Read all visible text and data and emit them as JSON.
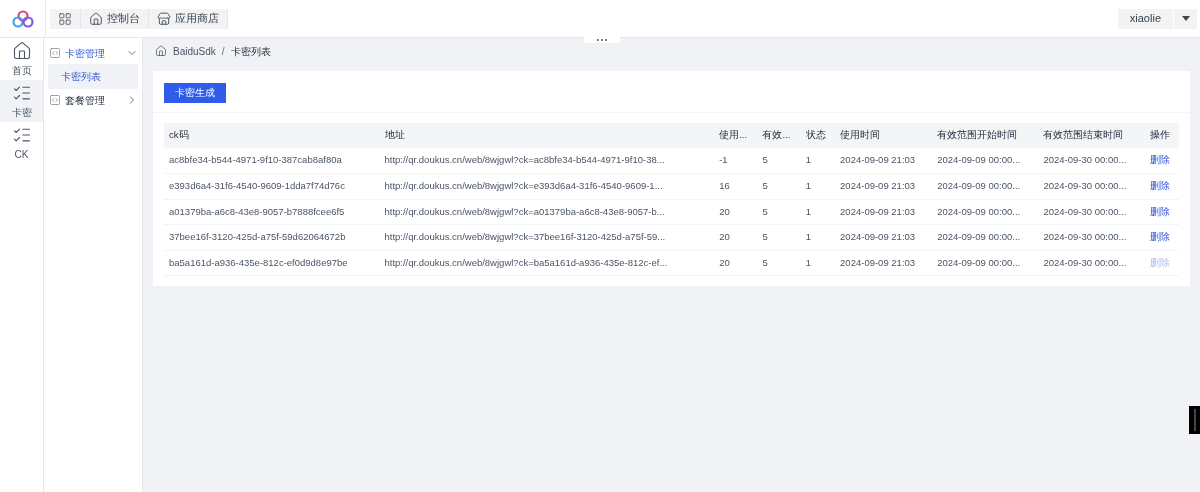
{
  "top_tabs": [
    {
      "label": "控制台",
      "kind": "home"
    },
    {
      "label": "应用商店",
      "kind": "store"
    }
  ],
  "user": {
    "name": "xiaolie"
  },
  "rail": [
    {
      "label": "首页",
      "kind": "home",
      "selected": false
    },
    {
      "label": "卡密",
      "kind": "list",
      "selected": true
    },
    {
      "label": "CK",
      "kind": "list",
      "selected": false
    }
  ],
  "menu": [
    {
      "label": "卡密管理",
      "expanded": true,
      "children": [
        {
          "label": "卡密列表",
          "selected": true
        }
      ]
    },
    {
      "label": "套餐管理",
      "expanded": false
    }
  ],
  "breadcrumb": {
    "items": [
      "BaiduSdk",
      "卡密列表"
    ],
    "separator": "/"
  },
  "generate_button": "卡密生成",
  "table": {
    "columns": [
      "ck码",
      "地址",
      "使用...",
      "有效...",
      "状态",
      "使用时间",
      "有效范围开始时间",
      "有效范围结束时间",
      "操作"
    ],
    "rows": [
      {
        "cells": [
          "ac8bfe34-b544-4971-9f10-387cab8af80a",
          "http://qr.doukus.cn/web/8wjgwl?ck=ac8bfe34-b544-4971-9f10-38...",
          "-1",
          "5",
          "1",
          "2024-09-09 21:03",
          "2024-09-09 00:00...",
          "2024-09-30 00:00..."
        ],
        "action": "删除",
        "disabled": false
      },
      {
        "cells": [
          "e393d6a4-31f6-4540-9609-1dda7f74d76c",
          "http://qr.doukus.cn/web/8wjgwl?ck=e393d6a4-31f6-4540-9609-1...",
          "16",
          "5",
          "1",
          "2024-09-09 21:03",
          "2024-09-09 00:00...",
          "2024-09-30 00:00..."
        ],
        "action": "删除",
        "disabled": false
      },
      {
        "cells": [
          "a01379ba-a6c8-43e8-9057-b7888fcee6f5",
          "http://qr.doukus.cn/web/8wjgwl?ck=a01379ba-a6c8-43e8-9057-b...",
          "20",
          "5",
          "1",
          "2024-09-09 21:03",
          "2024-09-09 00:00...",
          "2024-09-30 00:00..."
        ],
        "action": "删除",
        "disabled": false
      },
      {
        "cells": [
          "37bee16f-3120-425d-a75f-59d62064672b",
          "http://qr.doukus.cn/web/8wjgwl?ck=37bee16f-3120-425d-a75f-59...",
          "20",
          "5",
          "1",
          "2024-09-09 21:03",
          "2024-09-09 00:00...",
          "2024-09-30 00:00..."
        ],
        "action": "删除",
        "disabled": false
      },
      {
        "cells": [
          "ba5a161d-a936-435e-812c-ef0d9d8e97be",
          "http://qr.doukus.cn/web/8wjgwl?ck=ba5a161d-a936-435e-812c-ef...",
          "20",
          "5",
          "1",
          "2024-09-09 21:03",
          "2024-09-09 00:00...",
          "2024-09-30 00:00..."
        ],
        "action": "删除",
        "disabled": true
      }
    ]
  }
}
